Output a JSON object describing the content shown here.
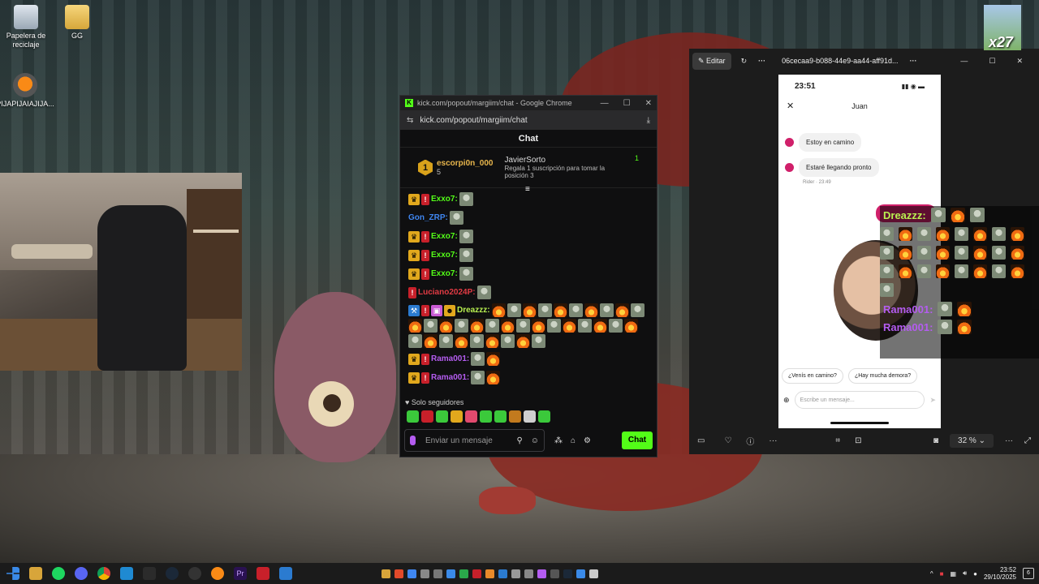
{
  "desktop": {
    "icons": [
      {
        "label": "Papelera de reciclaje",
        "icon": "recycle-bin-icon"
      },
      {
        "label": "GG",
        "icon": "folder-icon"
      },
      {
        "label": "PIJAPIJAIAJIJA...",
        "icon": "fl-studio-icon"
      }
    ],
    "corner_badge": "x27"
  },
  "chrome_popup": {
    "window_title": "kick.com/popout/margiim/chat - Google Chrome",
    "url": "kick.com/popout/margiim/chat",
    "chat_header": "Chat",
    "leaderboard": {
      "rank": "1",
      "top_user": "escorpi0n_000",
      "top_user_count": "5",
      "gift_user": "JavierSorto",
      "gift_note": "Regala 1 suscripción para tomar la posición 3",
      "gift_count": "1"
    },
    "messages": [
      {
        "user": "Exxo7:",
        "color": "#53fc18",
        "badges": [
          "crown",
          "red"
        ],
        "emotes": [
          "frog"
        ]
      },
      {
        "user": "Gon_ZRP:",
        "color": "#3f86f0",
        "badges": [],
        "emotes": [
          "frog"
        ]
      },
      {
        "user": "Exxo7:",
        "color": "#53fc18",
        "badges": [
          "crown",
          "red"
        ],
        "emotes": [
          "frog"
        ]
      },
      {
        "user": "Exxo7:",
        "color": "#53fc18",
        "badges": [
          "crown",
          "red"
        ],
        "emotes": [
          "frog"
        ]
      },
      {
        "user": "Exxo7:",
        "color": "#53fc18",
        "badges": [
          "crown",
          "red"
        ],
        "emotes": [
          "frog"
        ]
      },
      {
        "user": "Luciano2024P:",
        "color": "#e23b44",
        "badges": [
          "red"
        ],
        "emotes": [
          "frog"
        ]
      },
      {
        "user": "Dreazzz:",
        "color": "#b8f050",
        "badges": [
          "blue",
          "red",
          "pink",
          "gold"
        ],
        "emotes": [
          "fire",
          "frog",
          "fire",
          "frog",
          "fire",
          "frog",
          "fire",
          "frog",
          "fire",
          "frog",
          "fire",
          "frog",
          "fire",
          "frog",
          "fire",
          "frog",
          "fire",
          "frog",
          "fire",
          "frog",
          "fire",
          "frog",
          "fire",
          "frog",
          "fire",
          "frog",
          "fire",
          "frog",
          "fire",
          "frog",
          "fire",
          "frog",
          "fire",
          "frog"
        ]
      },
      {
        "user": "Rama001:",
        "color": "#b45cf0",
        "badges": [
          "crown",
          "red"
        ],
        "emotes": [
          "frog",
          "fire"
        ]
      },
      {
        "user": "Rama001:",
        "color": "#b45cf0",
        "badges": [
          "crown",
          "red"
        ],
        "emotes": [
          "frog",
          "fire"
        ]
      }
    ],
    "followers_only": "Solo seguidores",
    "input_placeholder": "Enviar un mensaje",
    "send_label": "Chat"
  },
  "photos_window": {
    "edit_label": "Editar",
    "file_title": "06cecaa9-b088-44e9-aa44-aff91d...",
    "zoom": "32 %",
    "phone": {
      "time": "23:51",
      "contact": "Juan",
      "bubble1": "Estoy en camino",
      "bubble2": "Estaré llegando pronto",
      "rider_meta": "Rider · 23:49",
      "chip1": "¿Venís en camino?",
      "chip2": "¿Hay mucha demora?",
      "compose_placeholder": "Escribe un mensaje..."
    }
  },
  "overlay_chat": [
    {
      "user": "Dreazzz:",
      "color": "#b8f050"
    },
    {
      "user": "Rama001:",
      "color": "#b45cf0"
    },
    {
      "user": "Rama001:",
      "color": "#b45cf0"
    }
  ],
  "taskbar": {
    "time": "23:52",
    "date": "29/10/2025",
    "notifications": "6"
  }
}
